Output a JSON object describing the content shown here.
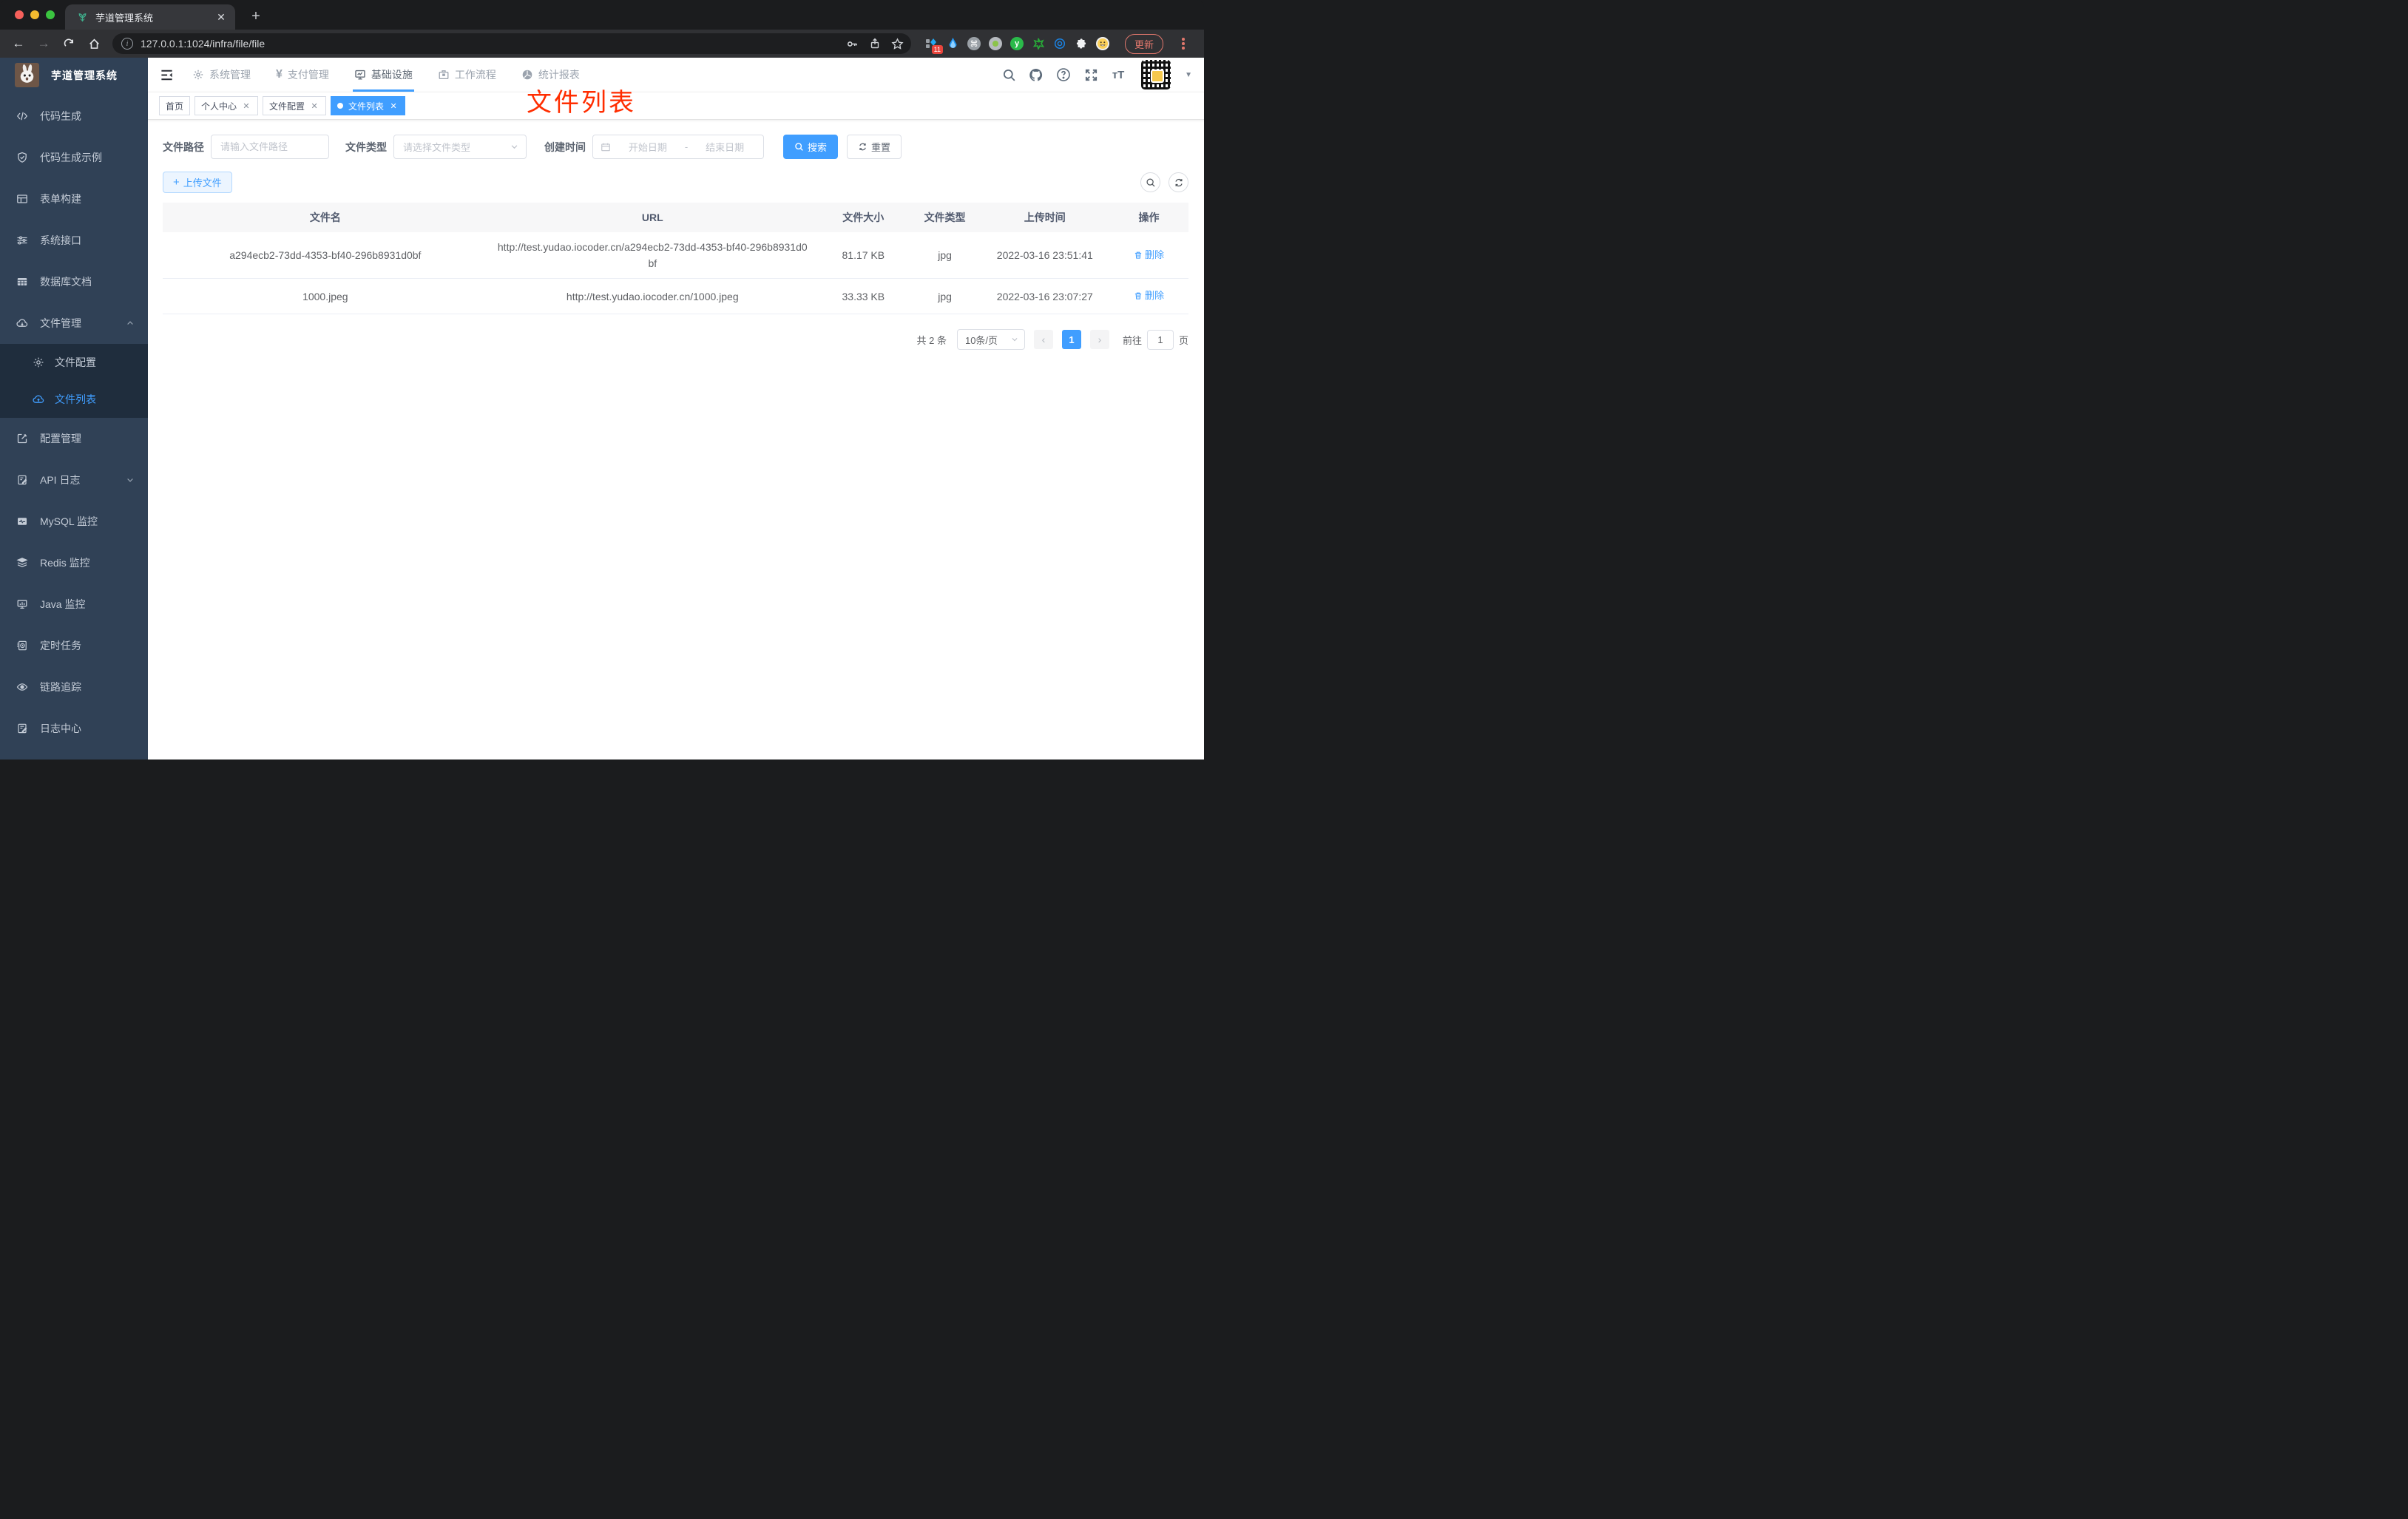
{
  "browser": {
    "tab_title": "芋道管理系统",
    "url": "127.0.0.1:1024/infra/file/file",
    "update_label": "更新",
    "extension_badge": "11"
  },
  "header": {
    "nav": [
      {
        "label": "系统管理"
      },
      {
        "label": "支付管理"
      },
      {
        "label": "基础设施"
      },
      {
        "label": "工作流程"
      },
      {
        "label": "统计报表"
      }
    ]
  },
  "sidebar": {
    "title": "芋道管理系统",
    "items": [
      {
        "label": "代码生成"
      },
      {
        "label": "代码生成示例"
      },
      {
        "label": "表单构建"
      },
      {
        "label": "系统接口"
      },
      {
        "label": "数据库文档"
      },
      {
        "label": "文件管理"
      },
      {
        "label": "配置管理"
      },
      {
        "label": "API 日志"
      },
      {
        "label": "MySQL 监控"
      },
      {
        "label": "Redis 监控"
      },
      {
        "label": "Java 监控"
      },
      {
        "label": "定时任务"
      },
      {
        "label": "链路追踪"
      },
      {
        "label": "日志中心"
      }
    ],
    "file_children": [
      {
        "label": "文件配置"
      },
      {
        "label": "文件列表"
      }
    ]
  },
  "tabs": [
    {
      "label": "首页"
    },
    {
      "label": "个人中心"
    },
    {
      "label": "文件配置"
    },
    {
      "label": "文件列表"
    }
  ],
  "annotation": "文件列表",
  "filters": {
    "path_label": "文件路径",
    "path_placeholder": "请输入文件路径",
    "type_label": "文件类型",
    "type_placeholder": "请选择文件类型",
    "time_label": "创建时间",
    "start_placeholder": "开始日期",
    "range_separator": "-",
    "end_placeholder": "结束日期",
    "search_label": "搜索",
    "reset_label": "重置"
  },
  "toolbar": {
    "upload_label": "上传文件"
  },
  "table": {
    "headers": [
      "文件名",
      "URL",
      "文件大小",
      "文件类型",
      "上传时间",
      "操作"
    ],
    "rows": [
      {
        "name": "a294ecb2-73dd-4353-bf40-296b8931d0bf",
        "url": "http://test.yudao.iocoder.cn/a294ecb2-73dd-4353-bf40-296b8931d0bf",
        "size": "81.17 KB",
        "type": "jpg",
        "time": "2022-03-16 23:51:41",
        "action": "删除"
      },
      {
        "name": "1000.jpeg",
        "url": "http://test.yudao.iocoder.cn/1000.jpeg",
        "size": "33.33 KB",
        "type": "jpg",
        "time": "2022-03-16 23:07:27",
        "action": "删除"
      }
    ]
  },
  "pagination": {
    "total": "共 2 条",
    "per_page": "10条/页",
    "page": "1",
    "goto_label": "前往",
    "goto_value": "1",
    "page_unit": "页"
  },
  "colors": {
    "primary": "#409EFF",
    "annotation_red": "#FF2D00",
    "sidebar_bg": "#304156",
    "sidebar_sub_bg": "#1F2D3D"
  }
}
